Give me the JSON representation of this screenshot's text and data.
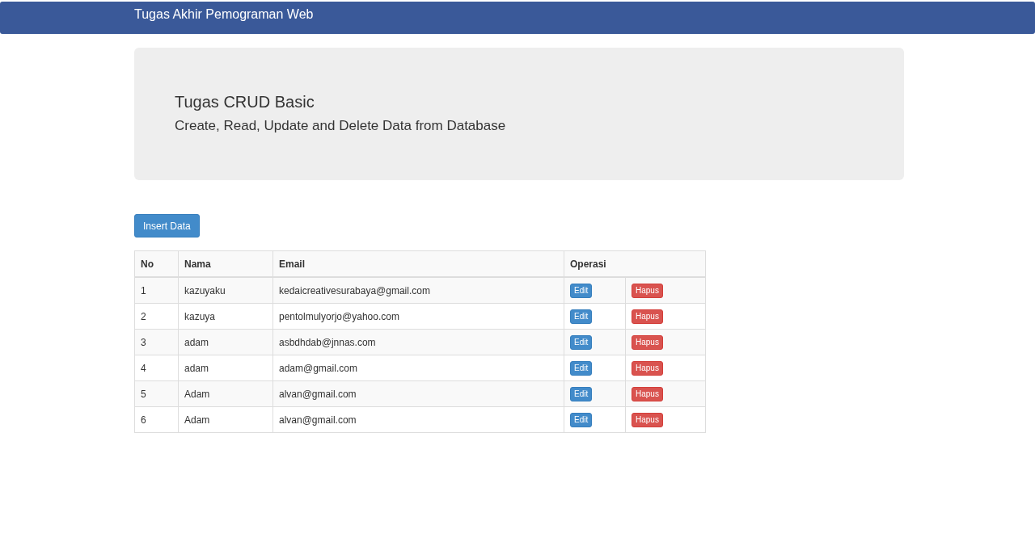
{
  "navbar": {
    "brand": "Tugas Akhir Pemograman Web"
  },
  "jumbotron": {
    "title": "Tugas CRUD Basic",
    "subtitle": "Create, Read, Update and Delete Data from Database"
  },
  "insert_button": "Insert Data",
  "table": {
    "columns": [
      "No",
      "Nama",
      "Email",
      "Operasi"
    ],
    "rows": [
      {
        "no": "1",
        "nama": "kazuyaku",
        "email": "kedaicreativesurabaya@gmail.com",
        "edit": "Edit",
        "delete": "Hapus"
      },
      {
        "no": "2",
        "nama": "kazuya",
        "email": "pentolmulyorjo@yahoo.com",
        "edit": "Edit",
        "delete": "Hapus"
      },
      {
        "no": "3",
        "nama": "adam",
        "email": "asbdhdab@jnnas.com",
        "edit": "Edit",
        "delete": "Hapus"
      },
      {
        "no": "4",
        "nama": "adam",
        "email": "adam@gmail.com",
        "edit": "Edit",
        "delete": "Hapus"
      },
      {
        "no": "5",
        "nama": "Adam",
        "email": "alvan@gmail.com",
        "edit": "Edit",
        "delete": "Hapus"
      },
      {
        "no": "6",
        "nama": "Adam",
        "email": "alvan@gmail.com",
        "edit": "Edit",
        "delete": "Hapus"
      }
    ]
  }
}
